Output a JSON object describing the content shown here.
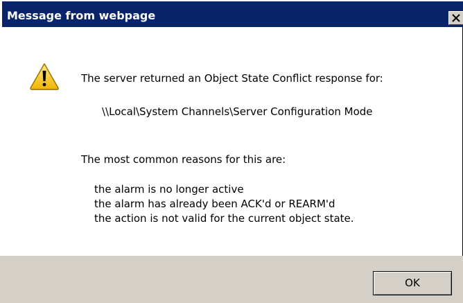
{
  "window": {
    "title": "Message from webpage"
  },
  "icons": {
    "message_icon": "warning-triangle",
    "close_icon": "close-x"
  },
  "message": {
    "intro": "The server returned an Object State Conflict response for:",
    "path": "\\\\Local\\System Channels\\Server Configuration Mode",
    "reasons_heading": "The most common reasons for this are:",
    "reasons": [
      "the alarm is no longer active",
      "the alarm has already been ACK'd or REARM'd",
      "the action is not valid for the current object state."
    ]
  },
  "buttons": {
    "ok_label": "OK"
  },
  "colors": {
    "title_bar": "#0a246a",
    "button_face": "#d4d0c8",
    "warning_yellow": "#f5c400"
  }
}
